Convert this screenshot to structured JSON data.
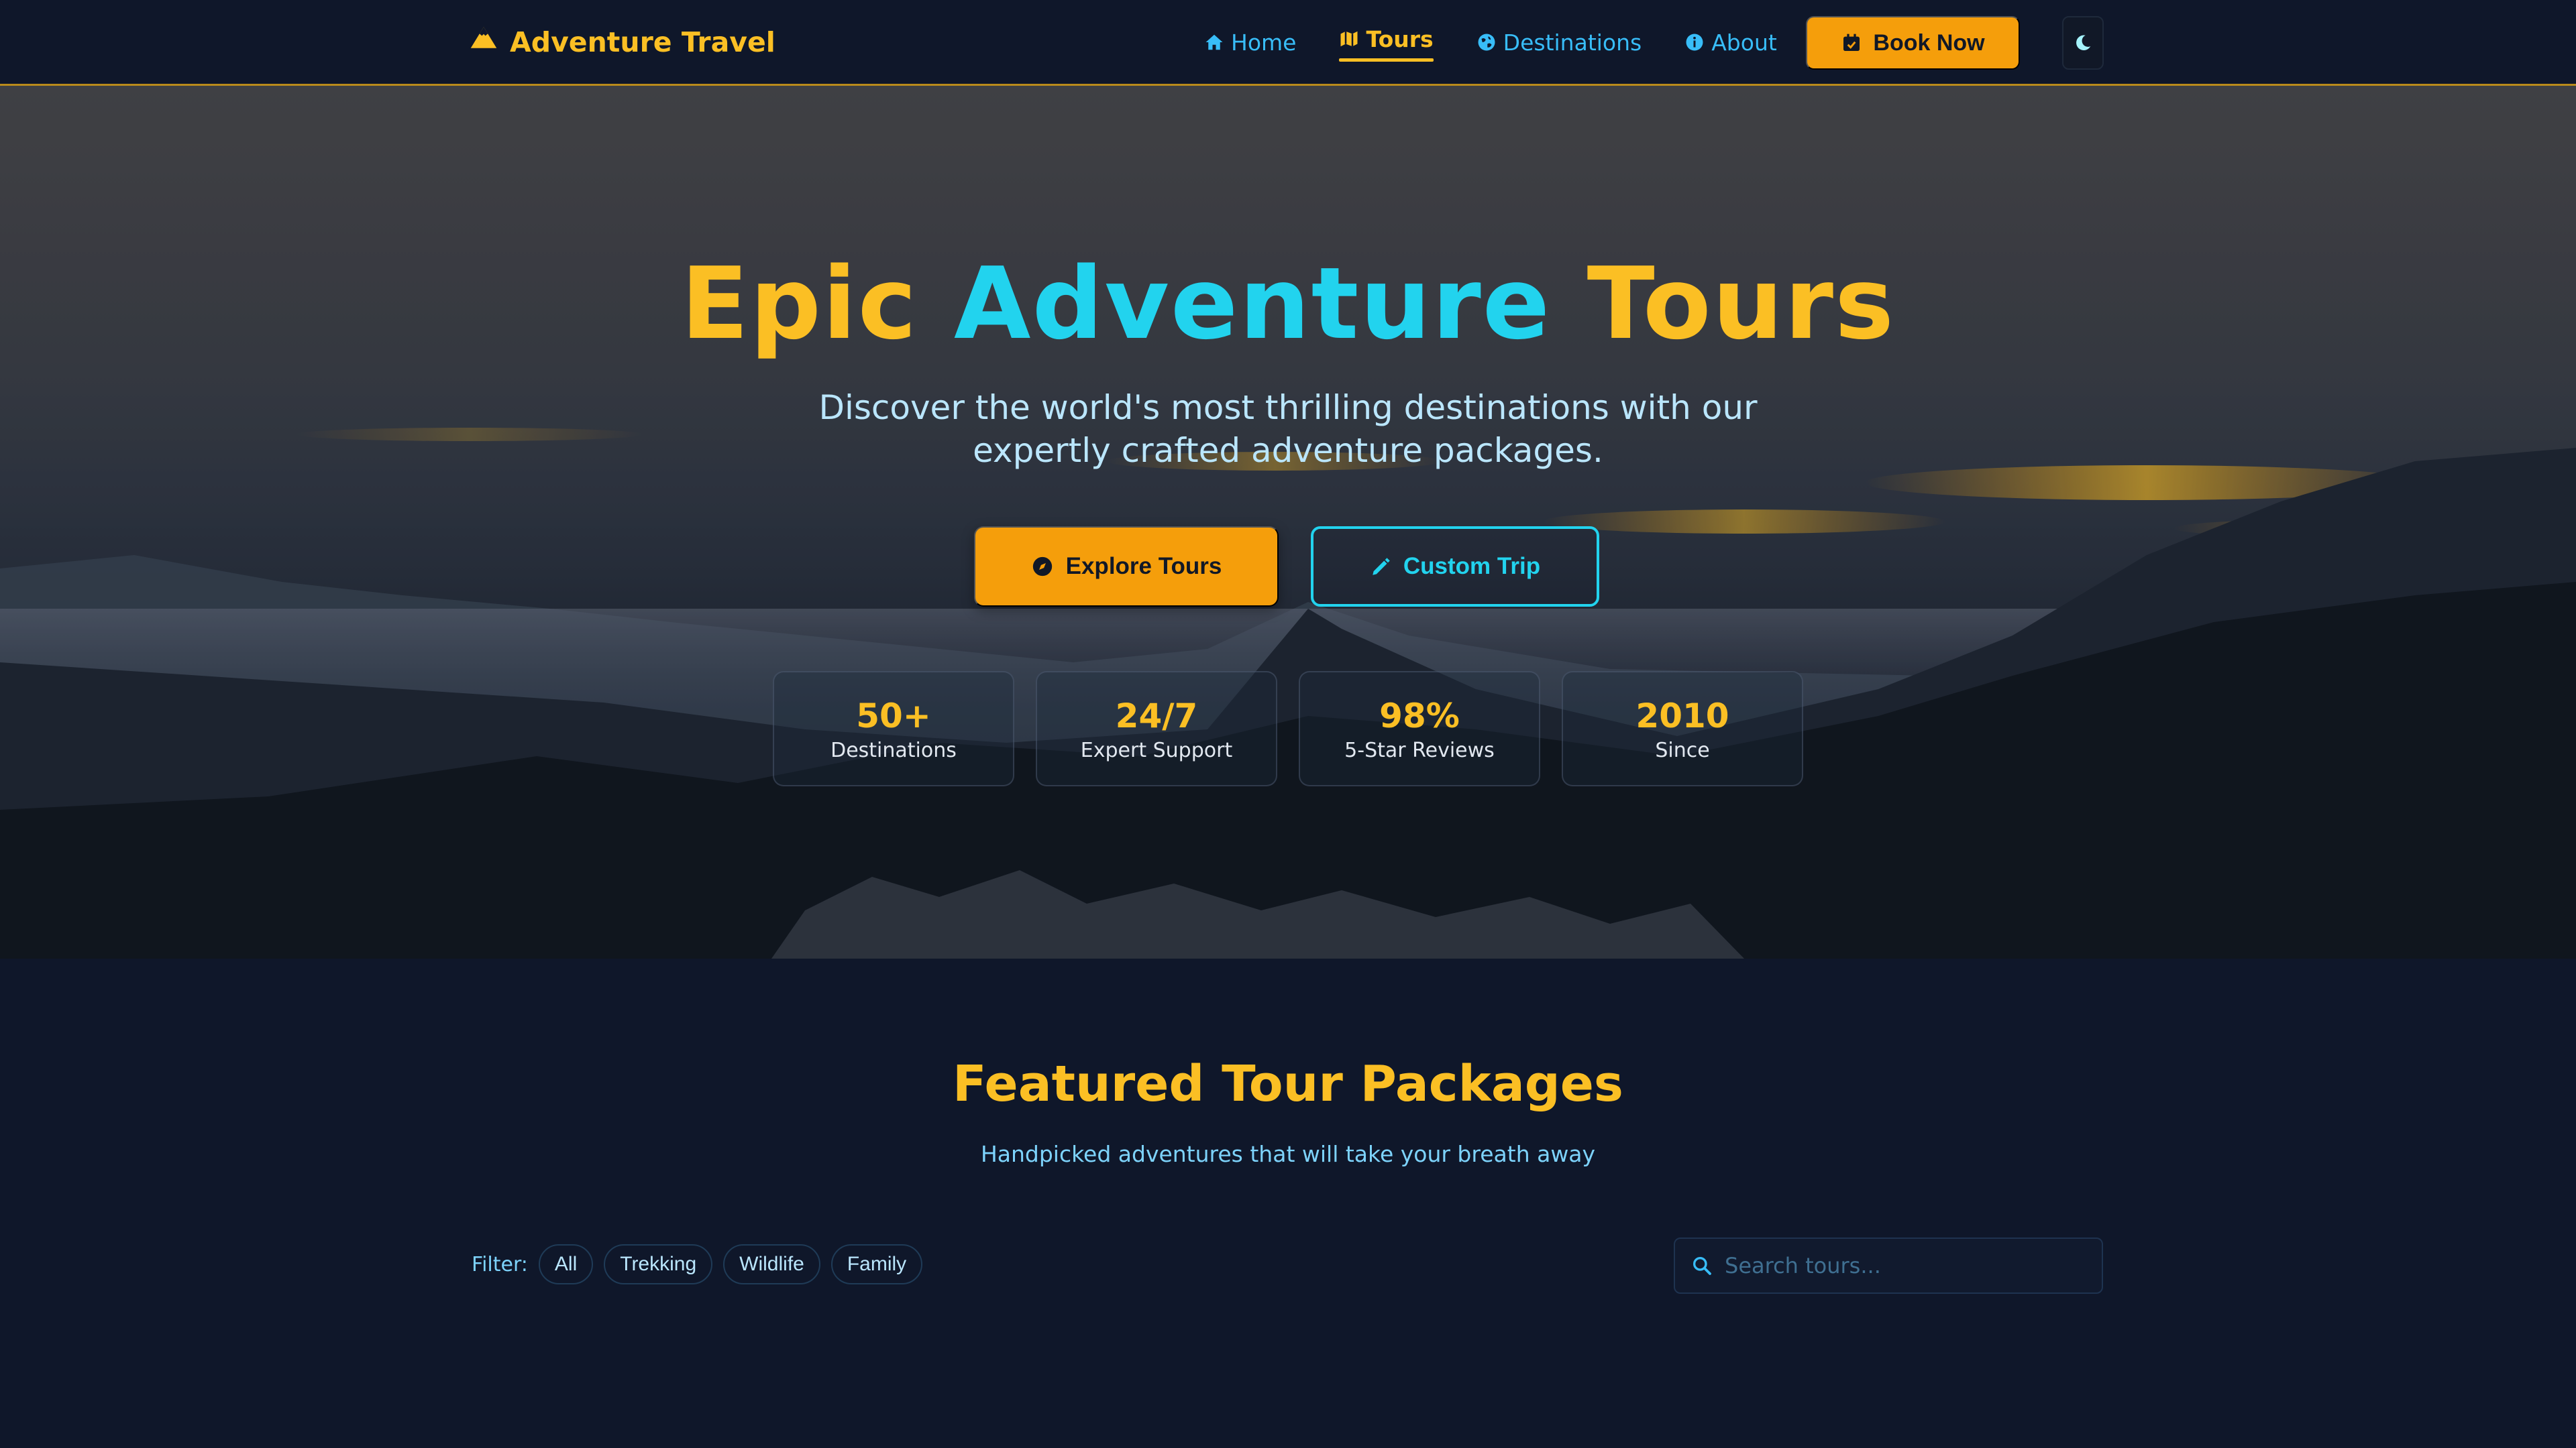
{
  "brand": {
    "name": "Adventure Travel",
    "icon": "mountain-icon"
  },
  "nav": {
    "items": [
      {
        "label": "Home",
        "icon": "home-icon",
        "active": false
      },
      {
        "label": "Tours",
        "icon": "map-icon",
        "active": true
      },
      {
        "label": "Destinations",
        "icon": "globe-icon",
        "active": false
      },
      {
        "label": "About",
        "icon": "info-icon",
        "active": false
      }
    ],
    "book_label": "Book Now",
    "book_icon": "calendar-icon",
    "theme_icon": "moon-icon"
  },
  "hero": {
    "title_word1": "Epic",
    "title_word2": "Adventure",
    "title_word3": "Tours",
    "subtitle": "Discover the world's most thrilling destinations with our expertly crafted adventure packages.",
    "explore_label": "Explore Tours",
    "explore_icon": "compass-icon",
    "custom_label": "Custom Trip",
    "custom_icon": "pencil-icon",
    "stats": [
      {
        "value": "50+",
        "label": "Destinations"
      },
      {
        "value": "24/7",
        "label": "Expert Support"
      },
      {
        "value": "98%",
        "label": "5-Star Reviews"
      },
      {
        "value": "2010",
        "label": "Since"
      }
    ]
  },
  "featured": {
    "title": "Featured Tour Packages",
    "subtitle": "Handpicked adventures that will take your breath away",
    "filter_label": "Filter:",
    "filters": [
      "All",
      "Trekking",
      "Wildlife",
      "Family"
    ],
    "search_placeholder": "Search tours..."
  },
  "colors": {
    "background": "#0f172a",
    "accent": "#fbbf24",
    "button": "#f59e0b",
    "secondary": "#22d3ee"
  }
}
